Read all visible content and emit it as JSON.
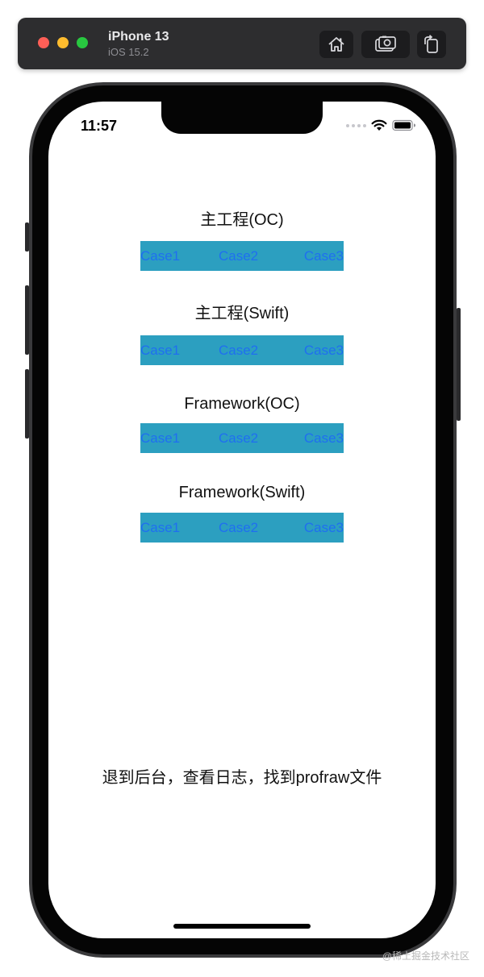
{
  "simulator": {
    "device_name": "iPhone 13",
    "os_version": "iOS 15.2",
    "buttons": {
      "home_icon": "home-icon",
      "screenshot_icon": "screenshot-icon",
      "rotate_icon": "rotate-icon"
    }
  },
  "status_bar": {
    "time": "11:57",
    "icons": [
      "cellular-signal-icon",
      "wifi-icon",
      "battery-icon"
    ]
  },
  "sections": [
    {
      "title": "主工程(OC)",
      "buttons": [
        {
          "label": "Case1"
        },
        {
          "label": "Case2"
        },
        {
          "label": "Case3"
        }
      ]
    },
    {
      "title": "主工程(Swift)",
      "buttons": [
        {
          "label": "Case1"
        },
        {
          "label": "Case2"
        },
        {
          "label": "Case3"
        }
      ]
    },
    {
      "title": "Framework(OC)",
      "buttons": [
        {
          "label": "Case1"
        },
        {
          "label": "Case2"
        },
        {
          "label": "Case3"
        }
      ]
    },
    {
      "title": "Framework(Swift)",
      "buttons": [
        {
          "label": "Case1"
        },
        {
          "label": "Case2"
        },
        {
          "label": "Case3"
        }
      ]
    }
  ],
  "footer": {
    "instruction": "退到后台，查看日志，找到profraw文件"
  },
  "watermark": "@稀土掘金技术社区",
  "colors": {
    "case_bar_bg": "#2c9fc0",
    "case_button_text": "#1f6ff0",
    "screen_bg": "#ffffff"
  }
}
